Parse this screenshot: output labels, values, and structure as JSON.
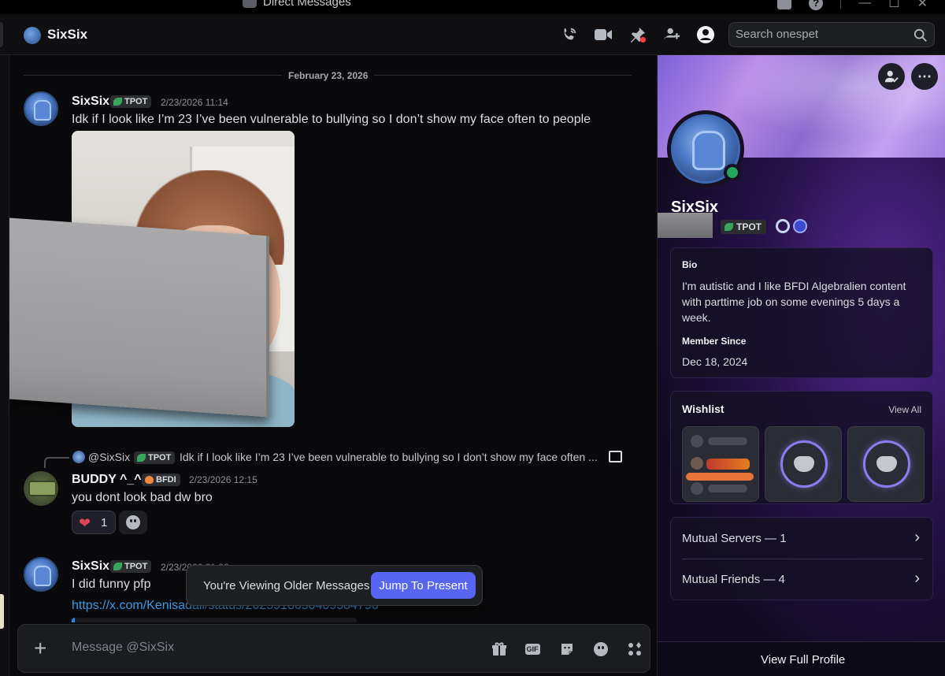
{
  "window": {
    "title": "Direct Messages"
  },
  "header": {
    "dm_name": "SixSix",
    "search_placeholder": "Search onespet"
  },
  "chat": {
    "date_divider": "February 23, 2026",
    "messages": [
      {
        "author": "SixSix",
        "tag": "TPOT",
        "timestamp": "2/23/2026 11:14",
        "text": "Idk if I look like I’m 23 I’ve been vulnerable to bullying so I don’t show my face often to people"
      },
      {
        "reply_to": {
          "author": "@SixSix",
          "tag": "TPOT",
          "text": "Idk if I look like I’m 23 I’ve been vulnerable to bullying so I don’t show my face often ..."
        },
        "author": "BUDDY ^_^",
        "tag": "BFDI",
        "timestamp": "2/23/2026 12:15",
        "text": "you dont look bad dw bro",
        "reactions": [
          {
            "emoji": "❤",
            "count": "1"
          }
        ]
      },
      {
        "author": "SixSix",
        "tag": "TPOT",
        "timestamp": "2/23/2026 21:08",
        "text": "I did funny pfp",
        "link": "https://x.com/Kenisadall/status/2025918650409584796"
      }
    ],
    "toast": {
      "message": "You're Viewing Older Messages",
      "button": "Jump To Present"
    },
    "composer": {
      "placeholder": "Message @SixSix"
    }
  },
  "profile": {
    "name": "SixSix",
    "tag": "TPOT",
    "bio_label": "Bio",
    "bio_text": "I'm autistic and I like BFDI Algebralien content with parttime job on some evenings 5 days a week.",
    "member_since_label": "Member Since",
    "member_since": "Dec 18, 2024",
    "wishlist_label": "Wishlist",
    "view_all": "View All",
    "mutual_servers": "Mutual Servers — 1",
    "mutual_friends": "Mutual Friends — 4",
    "view_full_profile": "View Full Profile"
  }
}
